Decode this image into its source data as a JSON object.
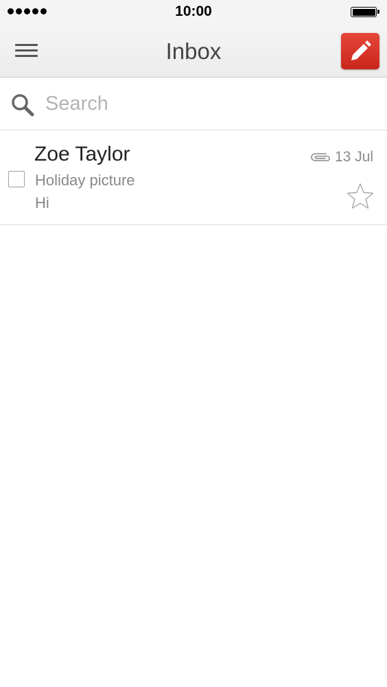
{
  "status_bar": {
    "time": "10:00",
    "signal_icon": "signal-dots-icon",
    "battery_icon": "battery-icon",
    "battery_level": 1.0
  },
  "nav": {
    "title": "Inbox",
    "menu_icon": "hamburger-menu-icon",
    "compose_icon": "pencil-icon",
    "compose_color": "#d8372c"
  },
  "search": {
    "placeholder": "Search",
    "value": "",
    "icon": "search-icon"
  },
  "messages": [
    {
      "sender": "Zoe Taylor",
      "subject": "Holiday picture",
      "snippet": "Hi",
      "date": "13 Jul",
      "has_attachment": true,
      "starred": false,
      "selected": false
    }
  ]
}
